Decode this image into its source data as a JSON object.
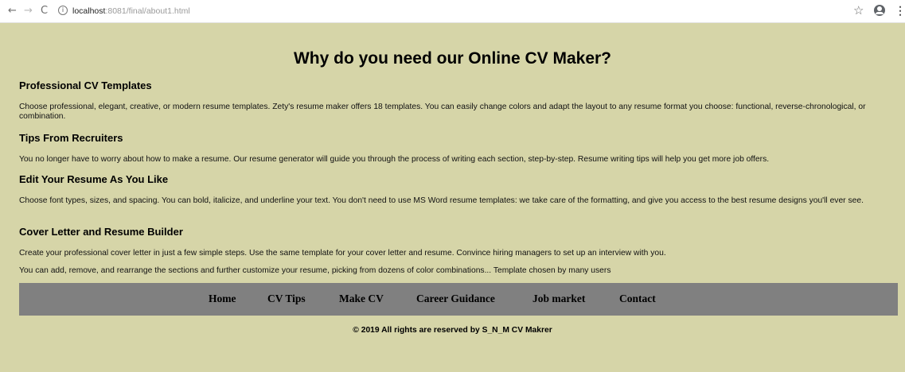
{
  "browser": {
    "back": "←",
    "forward": "→",
    "reload": "C",
    "url_host": "localhost",
    "url_rest": ":8081/final/about1.html",
    "star": "☆",
    "menu": "⋮"
  },
  "page": {
    "title": "Why do you need our Online CV Maker?",
    "sections": [
      {
        "heading": "Professional CV Templates",
        "text": "Choose professional, elegant, creative, or modern resume templates. Zety's resume maker offers 18 templates. You can easily change colors and adapt the layout to any resume format you choose: functional, reverse-chronological, or combination."
      },
      {
        "heading": "Tips From Recruiters",
        "text": "You no longer have to worry about how to make a resume. Our resume generator will guide you through the process of writing each section, step-by-step. Resume writing tips will help you get more job offers."
      },
      {
        "heading": "Edit Your Resume As You Like",
        "text": "Choose font types, sizes, and spacing. You can bold, italicize, and underline your text. You don't need to use MS Word resume templates: we take care of the formatting, and give you access to the best resume designs you'll ever see."
      },
      {
        "heading": "Cover Letter and Resume Builder",
        "text": "Create your professional cover letter in just a few simple steps. Use the same template for your cover letter and resume. Convince hiring managers to set up an interview with you."
      }
    ],
    "extra_text": "You can add, remove, and rearrange the sections and further customize your resume, picking from dozens of color combinations... Template chosen by many users"
  },
  "nav": {
    "items": [
      "Home",
      "CV Tips",
      "Make CV",
      "Career Guidance",
      "Job market",
      "Contact"
    ]
  },
  "footer": {
    "text": "© 2019 All rights are reserved by S_N_M CV Makrer"
  },
  "colors": {
    "page_background": "#d6d5a8",
    "nav_background": "#808080"
  }
}
